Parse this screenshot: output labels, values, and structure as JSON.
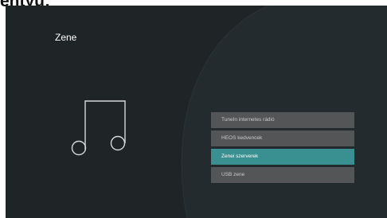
{
  "header": {
    "partial_text": "entyű:"
  },
  "screen": {
    "title": "Zene",
    "icon": "music-note-icon",
    "colors": {
      "background": "#1f2426",
      "menu_item": "#545557",
      "menu_item_selected": "#3a8f91"
    }
  },
  "menu": {
    "items": [
      {
        "label": "TuneIn internetes rádió",
        "selected": false
      },
      {
        "label": "HEOS kedvencek",
        "selected": false
      },
      {
        "label": "Zenei szerverek",
        "selected": true
      },
      {
        "label": "USB zene",
        "selected": false
      }
    ]
  }
}
